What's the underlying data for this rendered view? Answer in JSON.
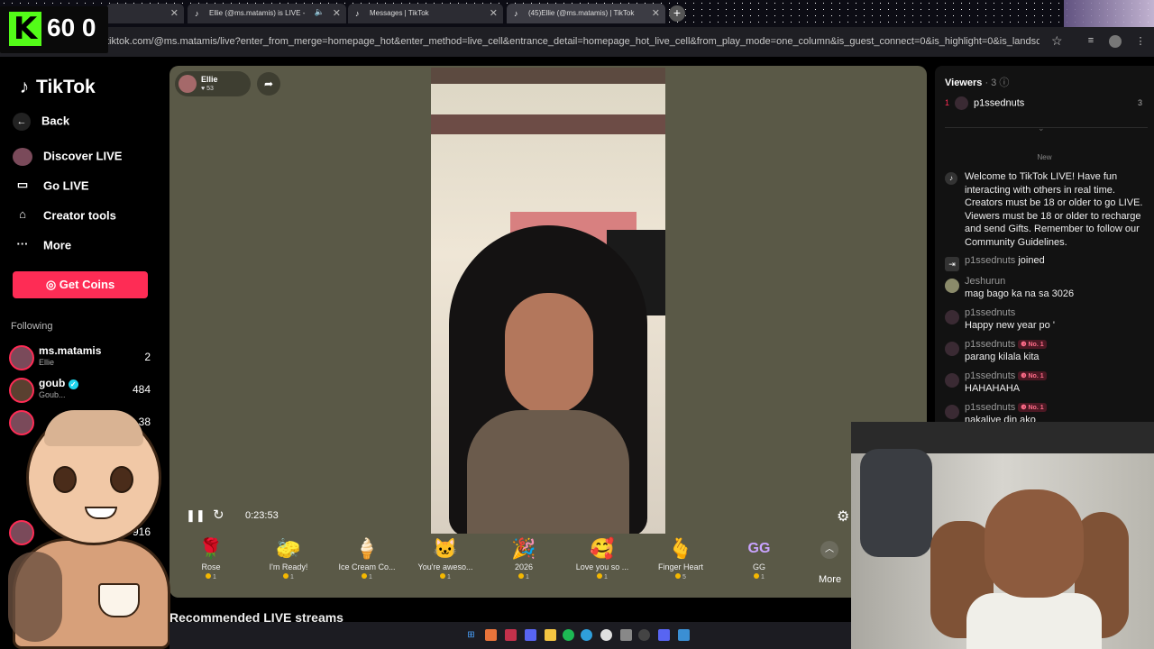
{
  "browser": {
    "tabs": [
      {
        "label": "",
        "active": false
      },
      {
        "label": "Ellie (@ms.matamis) is LIVE - ",
        "active": false
      },
      {
        "label": "Messages | TikTok",
        "active": false
      },
      {
        "label": "(45)Ellie (@ms.matamis) | TikTok",
        "active": true
      }
    ],
    "url": "tiktok.com/@ms.matamis/live?enter_from_merge=homepage_hot&enter_method=live_cell&entrance_detail=homepage_hot_live_cell&from_play_mode=one_column&is_guest_connect=0&is_highlight=0&is_landscape=0&re..."
  },
  "overlay": {
    "kick_logo": "K",
    "fps": "60 0"
  },
  "sidebar": {
    "brand": "TikTok",
    "back": "Back",
    "nav": [
      {
        "label": "Discover LIVE",
        "icon": "avatar-icon"
      },
      {
        "label": "Go LIVE",
        "icon": "camera-icon"
      },
      {
        "label": "Creator tools",
        "icon": "home-icon"
      },
      {
        "label": "More",
        "icon": "dots-icon"
      }
    ],
    "get_coins": "Get Coins",
    "following_title": "Following",
    "following": [
      {
        "name": "ms.matamis",
        "sub": "Ellie",
        "count": "2"
      },
      {
        "name": "goub",
        "sub": "Goub...",
        "count": "484"
      },
      {
        "name": "",
        "sub": "",
        "count": "38"
      },
      {
        "name": "",
        "sub": "",
        "count": "916"
      }
    ]
  },
  "stream": {
    "host_name": "Ellie",
    "host_likes": "53",
    "elapsed": "0:23:53",
    "gifts": [
      {
        "name": "Rose",
        "price": "1",
        "icon": "rose-icon",
        "glyph": "🌹"
      },
      {
        "name": "I'm Ready!",
        "price": "1",
        "icon": "sponge-icon",
        "glyph": "🧽"
      },
      {
        "name": "Ice Cream Co...",
        "price": "1",
        "icon": "ice-cream-icon",
        "glyph": "🍦"
      },
      {
        "name": "You're aweso...",
        "price": "1",
        "icon": "cat-icon",
        "glyph": "🐱"
      },
      {
        "name": "2026",
        "price": "1",
        "icon": "number-2026-icon",
        "glyph": "🎉"
      },
      {
        "name": "Love you so ...",
        "price": "1",
        "icon": "heart-face-icon",
        "glyph": "🥰"
      },
      {
        "name": "Finger Heart",
        "price": "5",
        "icon": "finger-heart-icon",
        "glyph": "🫰"
      },
      {
        "name": "GG",
        "price": "1",
        "icon": "gg-icon",
        "glyph": "GG"
      }
    ],
    "more": "More",
    "recommended": "Recommended LIVE streams"
  },
  "chat": {
    "viewers_label": "Viewers",
    "viewers_count": "· 3",
    "top_viewer": {
      "rank": "1",
      "name": "p1ssednuts",
      "value": "3"
    },
    "new_label": "New",
    "welcome": "Welcome to TikTok LIVE! Have fun interacting with others in real time. Creators must be 18 or older to go LIVE. Viewers must be 18 or older to recharge and send Gifts. Remember to follow our Community Guidelines.",
    "joined_user": "p1ssednuts",
    "joined_text": "joined",
    "messages": [
      {
        "user": "Jeshurun",
        "badge": "",
        "text": "mag bago ka na sa 3026"
      },
      {
        "user": "p1ssednuts",
        "badge": "",
        "text": "Happy new year po '"
      },
      {
        "user": "p1ssednuts",
        "badge": "No. 1",
        "text": "parang kilala kita"
      },
      {
        "user": "p1ssednuts",
        "badge": "No. 1",
        "text": "HAHAHAHA"
      },
      {
        "user": "p1ssednuts",
        "badge": "No. 1",
        "text": "nakalive din ako"
      }
    ]
  },
  "colors": {
    "accent": "#fe2c55",
    "stage": "#5a5947",
    "kick": "#53fc18"
  }
}
